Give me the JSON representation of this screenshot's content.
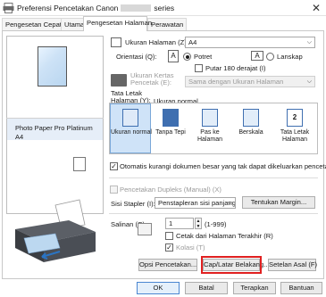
{
  "window": {
    "title_left": "Preferensi Pencetakan Canon",
    "title_right": "series",
    "close_glyph": "✕"
  },
  "tabs": [
    {
      "label": "Pengesetan Cepat"
    },
    {
      "label": "Utama"
    },
    {
      "label": "Pengesetan Halaman"
    },
    {
      "label": "Perawatan"
    }
  ],
  "preview": {
    "media_name": "Photo Paper Pro Platinum",
    "media_size": "A4"
  },
  "page_setup": {
    "page_size_label": "Ukuran Halaman (Z):",
    "page_size_value": "A4",
    "orientation_label": "Orientasi (Q):",
    "portrait_label": "Potret",
    "landscape_label": "Lanskap",
    "rotate_label": "Putar 180 derajat (I)",
    "output_paper_label_1": "Ukuran Kertas",
    "output_paper_label_2": "Pencetak (E):",
    "output_paper_value": "Sama dengan Ukuran Halaman",
    "layout_label_1": "Tata Letak",
    "layout_label_2": "Halaman (Y):",
    "layout_value": "Ukuran normal",
    "layouts": [
      {
        "label_1": "Ukuran normal",
        "label_2": ""
      },
      {
        "label_1": "Tanpa Tepi",
        "label_2": ""
      },
      {
        "label_1": "Pas ke",
        "label_2": "Halaman"
      },
      {
        "label_1": "Berskala",
        "label_2": ""
      },
      {
        "label_1": "Tata Letak",
        "label_2": "Halaman"
      }
    ],
    "tile_number": "2",
    "auto_reduce_label": "Otomatis kurangi dokumen besar yang tak dapat dikeluarkan pencetak",
    "duplex_label": "Pencetakan Dupleks (Manual) (X)",
    "stapling_label": "Sisi Stapler (I):",
    "stapling_value": "Penstapleran sisi panjang (Kiri)",
    "margin_button": "Tentukan Margin...",
    "copies_label": "Salinan (C):",
    "copies_value": "1",
    "copies_range": "(1-999)",
    "last_page_label": "Cetak dari Halaman Terakhir (R)",
    "collate_label": "Kolasi (T)",
    "print_options_button": "Opsi Pencetakan...",
    "stamp_button": "Cap/Latar Belakang...",
    "defaults_button": "Setelan Asal (F)"
  },
  "footer": {
    "ok": "OK",
    "cancel": "Batal",
    "apply": "Terapkan",
    "help": "Bantuan"
  },
  "colors": {
    "highlight": "#e02020",
    "accent_blue": "#3f6fb0"
  }
}
